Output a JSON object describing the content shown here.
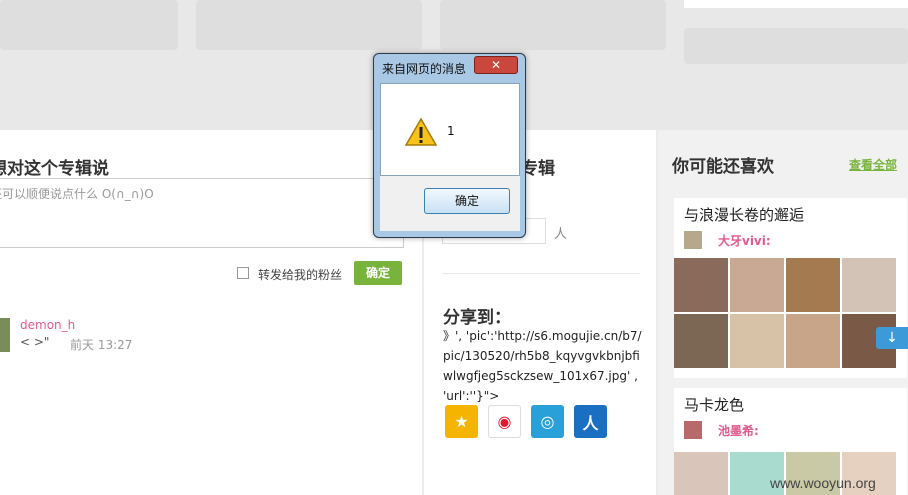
{
  "comment": {
    "title": "想对这个专辑说",
    "placeholder": "还可以顺便说点什么 O(∩_∩)O",
    "forward_label": "转发给我的粉丝",
    "submit_label": "确定"
  },
  "comments": [
    {
      "user": "demon_h",
      "text": "< >\"",
      "time": "前天 13:27"
    }
  ],
  "middle": {
    "title": "个专辑",
    "unit": "人",
    "share_title": "分享到：",
    "share_text": "》', 'pic':'http://s6.mogujie.cn/b7/pic/130520/rh5b8_kqyvgvkbnjbfiwlwgfjeg5sckzsew_101x67.jpg' , 'url':''}\">",
    "share_icons": [
      {
        "name": "qzone-icon",
        "glyph": "★",
        "color": "#f5b400"
      },
      {
        "name": "weibo-icon",
        "glyph": "◉",
        "color": "#e6162d"
      },
      {
        "name": "tencent-weibo-icon",
        "glyph": "◎",
        "color": "#2aa0d8"
      },
      {
        "name": "renren-icon",
        "glyph": "人",
        "color": "#1a6fc3"
      }
    ]
  },
  "recommend": {
    "title": "你可能还喜欢",
    "view_all": "查看全部",
    "cards": [
      {
        "title": "与浪漫长卷的邂逅",
        "user": "大牙vivi:",
        "thumb_colors": [
          "#8a6a5a",
          "#c9a994",
          "#a47a50",
          "#d3c2b6",
          "#7c6654",
          "#d7c1a7",
          "#c8a488",
          "#7a5a46"
        ]
      },
      {
        "title": "马卡龙色",
        "user": "池墨希:",
        "thumb_colors": [
          "#d8c6bb",
          "#a9dccf",
          "#c9c9a6",
          "#e6d1c0"
        ]
      }
    ]
  },
  "dialog": {
    "title": "来自网页的消息",
    "close_label": "✕",
    "message": "1",
    "ok_label": "确定"
  },
  "watermark": "www.wooyun.org"
}
